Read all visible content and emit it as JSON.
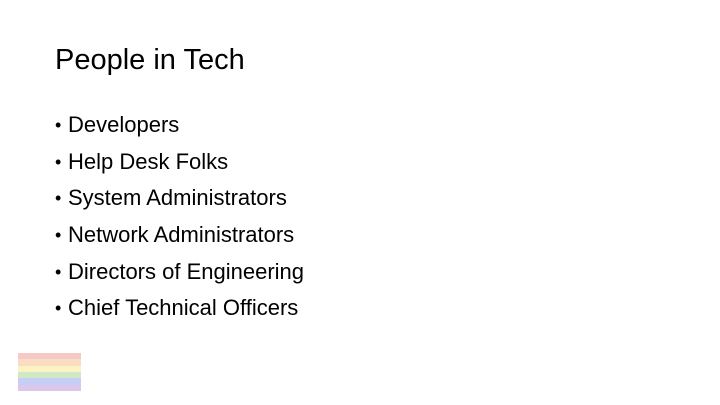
{
  "slide": {
    "title": "People in Tech",
    "bullets": [
      "Developers",
      "Help Desk Folks",
      "System Administrators",
      "Network Administrators",
      "Directors of Engineering",
      "Chief Technical Officers"
    ],
    "bullet_symbol": "•"
  },
  "flag": {
    "icon": "pride-flag-icon",
    "stripes": [
      "#f6c9c6",
      "#f9ddc2",
      "#fbf4c2",
      "#cfe8c6",
      "#c6cff3",
      "#dcc7ec"
    ]
  }
}
